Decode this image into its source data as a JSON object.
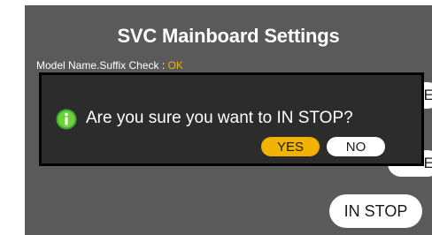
{
  "screen": {
    "title": "SVC Mainboard Settings",
    "model_check_label": "Model Name.Suffix Check : ",
    "model_check_value": "OK"
  },
  "side_buttons": {
    "top_partial": "E",
    "middle_partial": "E",
    "in_stop": "IN STOP"
  },
  "dialog": {
    "icon": "info-icon",
    "message": "Are you sure you want to IN STOP?",
    "yes_label": "YES",
    "no_label": "NO"
  },
  "colors": {
    "accent": "#f2b200",
    "background": "#5a5a5a",
    "dialog_bg": "#2c2c2c",
    "info_icon_green": "#3aaa35"
  }
}
